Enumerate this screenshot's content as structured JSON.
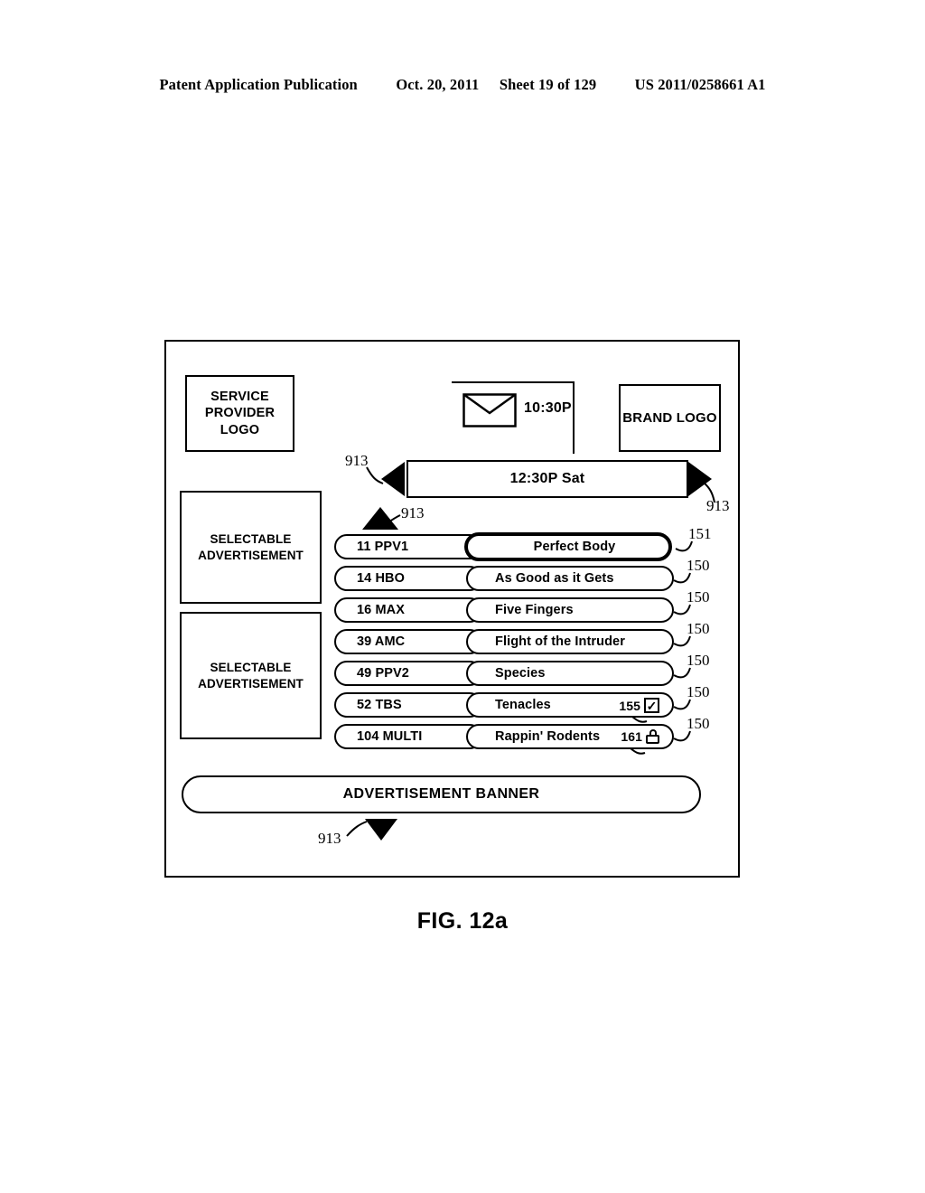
{
  "header": {
    "publication": "Patent Application Publication",
    "date": "Oct. 20, 2011",
    "sheet": "Sheet 19 of 129",
    "number": "US 2011/0258661 A1"
  },
  "figure": {
    "caption": "FIG. 12a"
  },
  "screen": {
    "service_provider_logo": "SERVICE PROVIDER LOGO",
    "brand_logo": "BRAND LOGO",
    "clock": {
      "time": "10:30P",
      "icon": "envelope-icon"
    },
    "time_bar": {
      "label": "12:30P Sat",
      "prev_icon": "triangle-left-icon",
      "next_icon": "triangle-right-icon"
    },
    "scroll": {
      "up_icon": "triangle-up-icon",
      "down_icon": "triangle-down-icon"
    },
    "ads": {
      "slot_1": "SELECTABLE ADVERTISEMENT",
      "slot_2": "SELECTABLE ADVERTISEMENT",
      "banner": "ADVERTISEMENT BANNER"
    },
    "rows": [
      {
        "channel": "11 PPV1",
        "program": "Perfect Body",
        "selected": true,
        "ref": "151",
        "badge": null
      },
      {
        "channel": "14 HBO",
        "program": "As Good as it Gets",
        "selected": false,
        "ref": "150",
        "badge": null
      },
      {
        "channel": "16 MAX",
        "program": "Five Fingers",
        "selected": false,
        "ref": "150",
        "badge": null
      },
      {
        "channel": "39 AMC",
        "program": "Flight of the Intruder",
        "selected": false,
        "ref": "150",
        "badge": null
      },
      {
        "channel": "49 PPV2",
        "program": "Species",
        "selected": false,
        "ref": "150",
        "badge": null
      },
      {
        "channel": "52 TBS",
        "program": "Tenacles",
        "selected": false,
        "ref": "150",
        "badge": {
          "number": "155",
          "icon": "checkbox-checked-icon",
          "glyph": "✓"
        }
      },
      {
        "channel": "104 MULTI",
        "program": "Rappin' Rodents",
        "selected": false,
        "ref": "150",
        "badge": {
          "number": "161",
          "icon": "padlock-icon",
          "glyph": ""
        }
      }
    ]
  },
  "callouts": {
    "nav_prev": "913",
    "nav_next": "913",
    "nav_up": "913",
    "nav_down": "913",
    "selected_row_ref": "151",
    "row_ref": "150",
    "checkbox_ref": "155",
    "lock_ref": "161"
  }
}
